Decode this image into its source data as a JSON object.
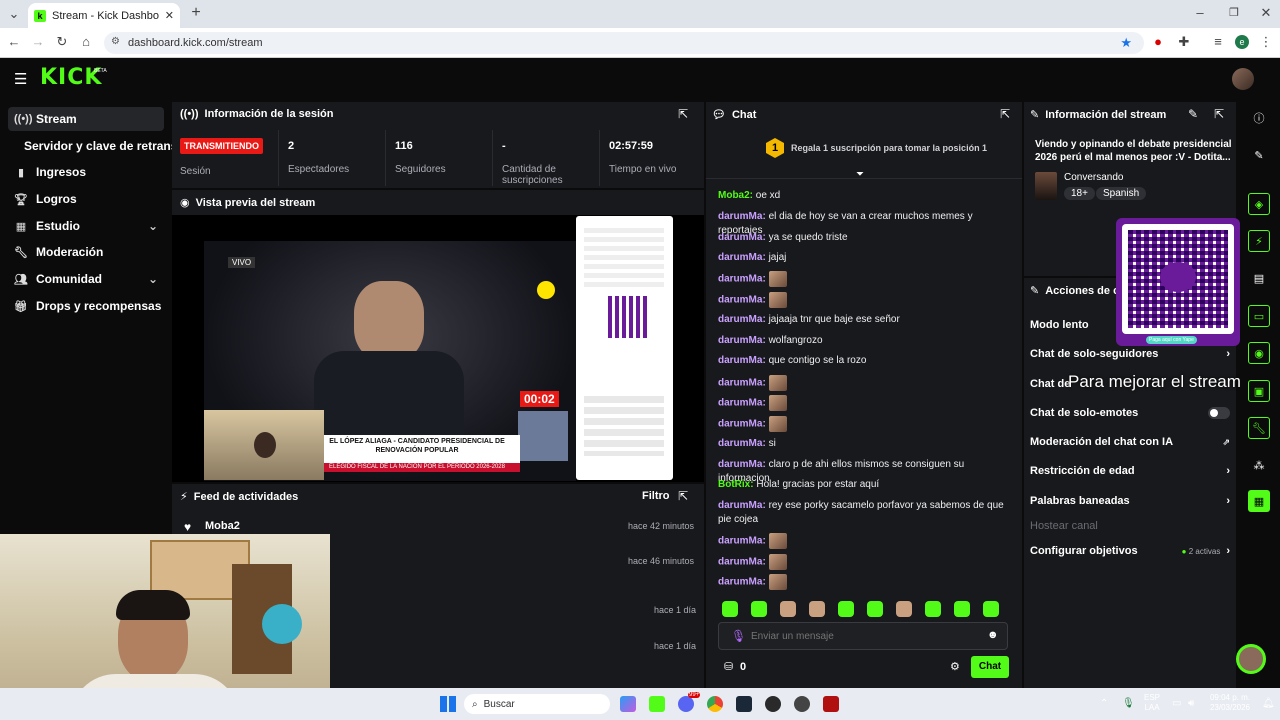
{
  "browser": {
    "tab_title": "Stream - Kick Dashboard",
    "url": "dashboard.kick.com/stream"
  },
  "brand": {
    "logo": "KICK",
    "beta": "BETA",
    "accent": "#53fc18"
  },
  "sidebar": {
    "items": [
      {
        "label": "Stream",
        "icon": "broadcast-icon"
      },
      {
        "label": "Servidor y clave de retransm",
        "icon": ""
      },
      {
        "label": "Ingresos",
        "icon": "chart-icon"
      },
      {
        "label": "Logros",
        "icon": "trophy-icon"
      },
      {
        "label": "Estudio",
        "icon": "grid-icon"
      },
      {
        "label": "Moderación",
        "icon": "wrench-icon"
      },
      {
        "label": "Comunidad",
        "icon": "people-icon"
      },
      {
        "label": "Drops y recompensas",
        "icon": "gift-icon"
      }
    ]
  },
  "session": {
    "title": "Información de la sesión",
    "status": "TRANSMITIENDO",
    "status_label": "Sesión",
    "viewers": "2",
    "viewers_label": "Espectadores",
    "followers": "116",
    "followers_label": "Seguidores",
    "subs": "-",
    "subs_label": "Cantidad de suscripciones",
    "uptime": "02:57:59",
    "uptime_label": "Tiempo en vivo"
  },
  "preview": {
    "title": "Vista previa del stream",
    "live_tag": "VIVO",
    "timer": "00:02",
    "banner_line1": "EL LÓPEZ ALIAGA - CANDIDATO PRESIDENCIAL DE",
    "banner_line2": "RENOVACIÓN POPULAR",
    "banner_line3": "ELEGIDO FISCAL DE LA NACIÓN POR EL PERIODO 2026-2028"
  },
  "feed": {
    "title": "Feed de actividades",
    "filter": "Filtro",
    "items": [
      {
        "user": "Moba2",
        "time": "hace 42 minutos"
      },
      {
        "user": "",
        "time": "hace 46 minutos"
      },
      {
        "user": "",
        "time": "hace 1 día"
      },
      {
        "user": "",
        "time": "hace 1 día"
      }
    ]
  },
  "chat": {
    "title": "Chat",
    "gift_rank": "1",
    "gift_text": "Regala 1 suscripción para tomar la posición 1",
    "messages": [
      {
        "user": "Moba2:",
        "text": "oe xd",
        "emotes": 0
      },
      {
        "user": "darumMa:",
        "text": "el dia de hoy se van a crear muchos memes y reportajes",
        "emotes": 0
      },
      {
        "user": "darumMa:",
        "text": "ya se quedo triste",
        "emotes": 0
      },
      {
        "user": "darumMa:",
        "text": "jajaj",
        "emotes": 0
      },
      {
        "user": "darumMa:",
        "text": "",
        "emotes": 1
      },
      {
        "user": "darumMa:",
        "text": "",
        "emotes": 1
      },
      {
        "user": "darumMa:",
        "text": "jajaaja tnr que baje ese señor",
        "emotes": 0
      },
      {
        "user": "darumMa:",
        "text": "wolfangrozo",
        "emotes": 0
      },
      {
        "user": "darumMa:",
        "text": "que contigo se la rozo",
        "emotes": 0
      },
      {
        "user": "darumMa:",
        "text": "",
        "emotes": 1
      },
      {
        "user": "darumMa:",
        "text": "",
        "emotes": 1
      },
      {
        "user": "darumMa:",
        "text": "",
        "emotes": 1
      },
      {
        "user": "darumMa:",
        "text": "si",
        "emotes": 0
      },
      {
        "user": "darumMa:",
        "text": "claro p de ahi ellos mismos se consiguen su informacion",
        "emotes": 0
      },
      {
        "user": "BotRix:",
        "text": "Hola! gracias por estar aquí",
        "emotes": 0
      },
      {
        "user": "darumMa:",
        "text": "rey ese porky sacamelo porfavor ya sabemos de que pie cojea",
        "emotes": 0
      },
      {
        "user": "darumMa:",
        "text": "",
        "emotes": 1
      },
      {
        "user": "darumMa:",
        "text": "",
        "emotes": 1
      },
      {
        "user": "darumMa:",
        "text": "",
        "emotes": 1
      }
    ],
    "input_placeholder": "Enviar un mensaje",
    "points": "0",
    "send_label": "Chat"
  },
  "stream_info": {
    "title": "Información del stream",
    "stream_title": "Viendo y opinando el debate presidencial 2026 perú el mal menos peor :V - Dotita...",
    "category": "Conversando",
    "tags": [
      "18+",
      "Spanish"
    ]
  },
  "actions": {
    "title": "Acciones de ca",
    "slow_mode": "Modo lento",
    "followers_only": "Chat de solo-seguidores",
    "subs_only": "Chat de solo-suscriptores",
    "emotes_only": "Chat de solo-emotes",
    "ai_mod": "Moderación del chat con IA",
    "age": "Restricción de edad",
    "banned_words": "Palabras baneadas",
    "host": "Hostear canal",
    "goals": "Configurar objetivos",
    "goals_status": "2 activas"
  },
  "overlay": {
    "caption": "Para mejorar el stream",
    "qr_caption": "Paga aquí con Yape"
  },
  "taskbar": {
    "search": "Buscar",
    "lang1": "ESP",
    "lang2": "LAA",
    "time": "09:04 p. m.",
    "date": "23/03/2026",
    "notif": "99+"
  }
}
